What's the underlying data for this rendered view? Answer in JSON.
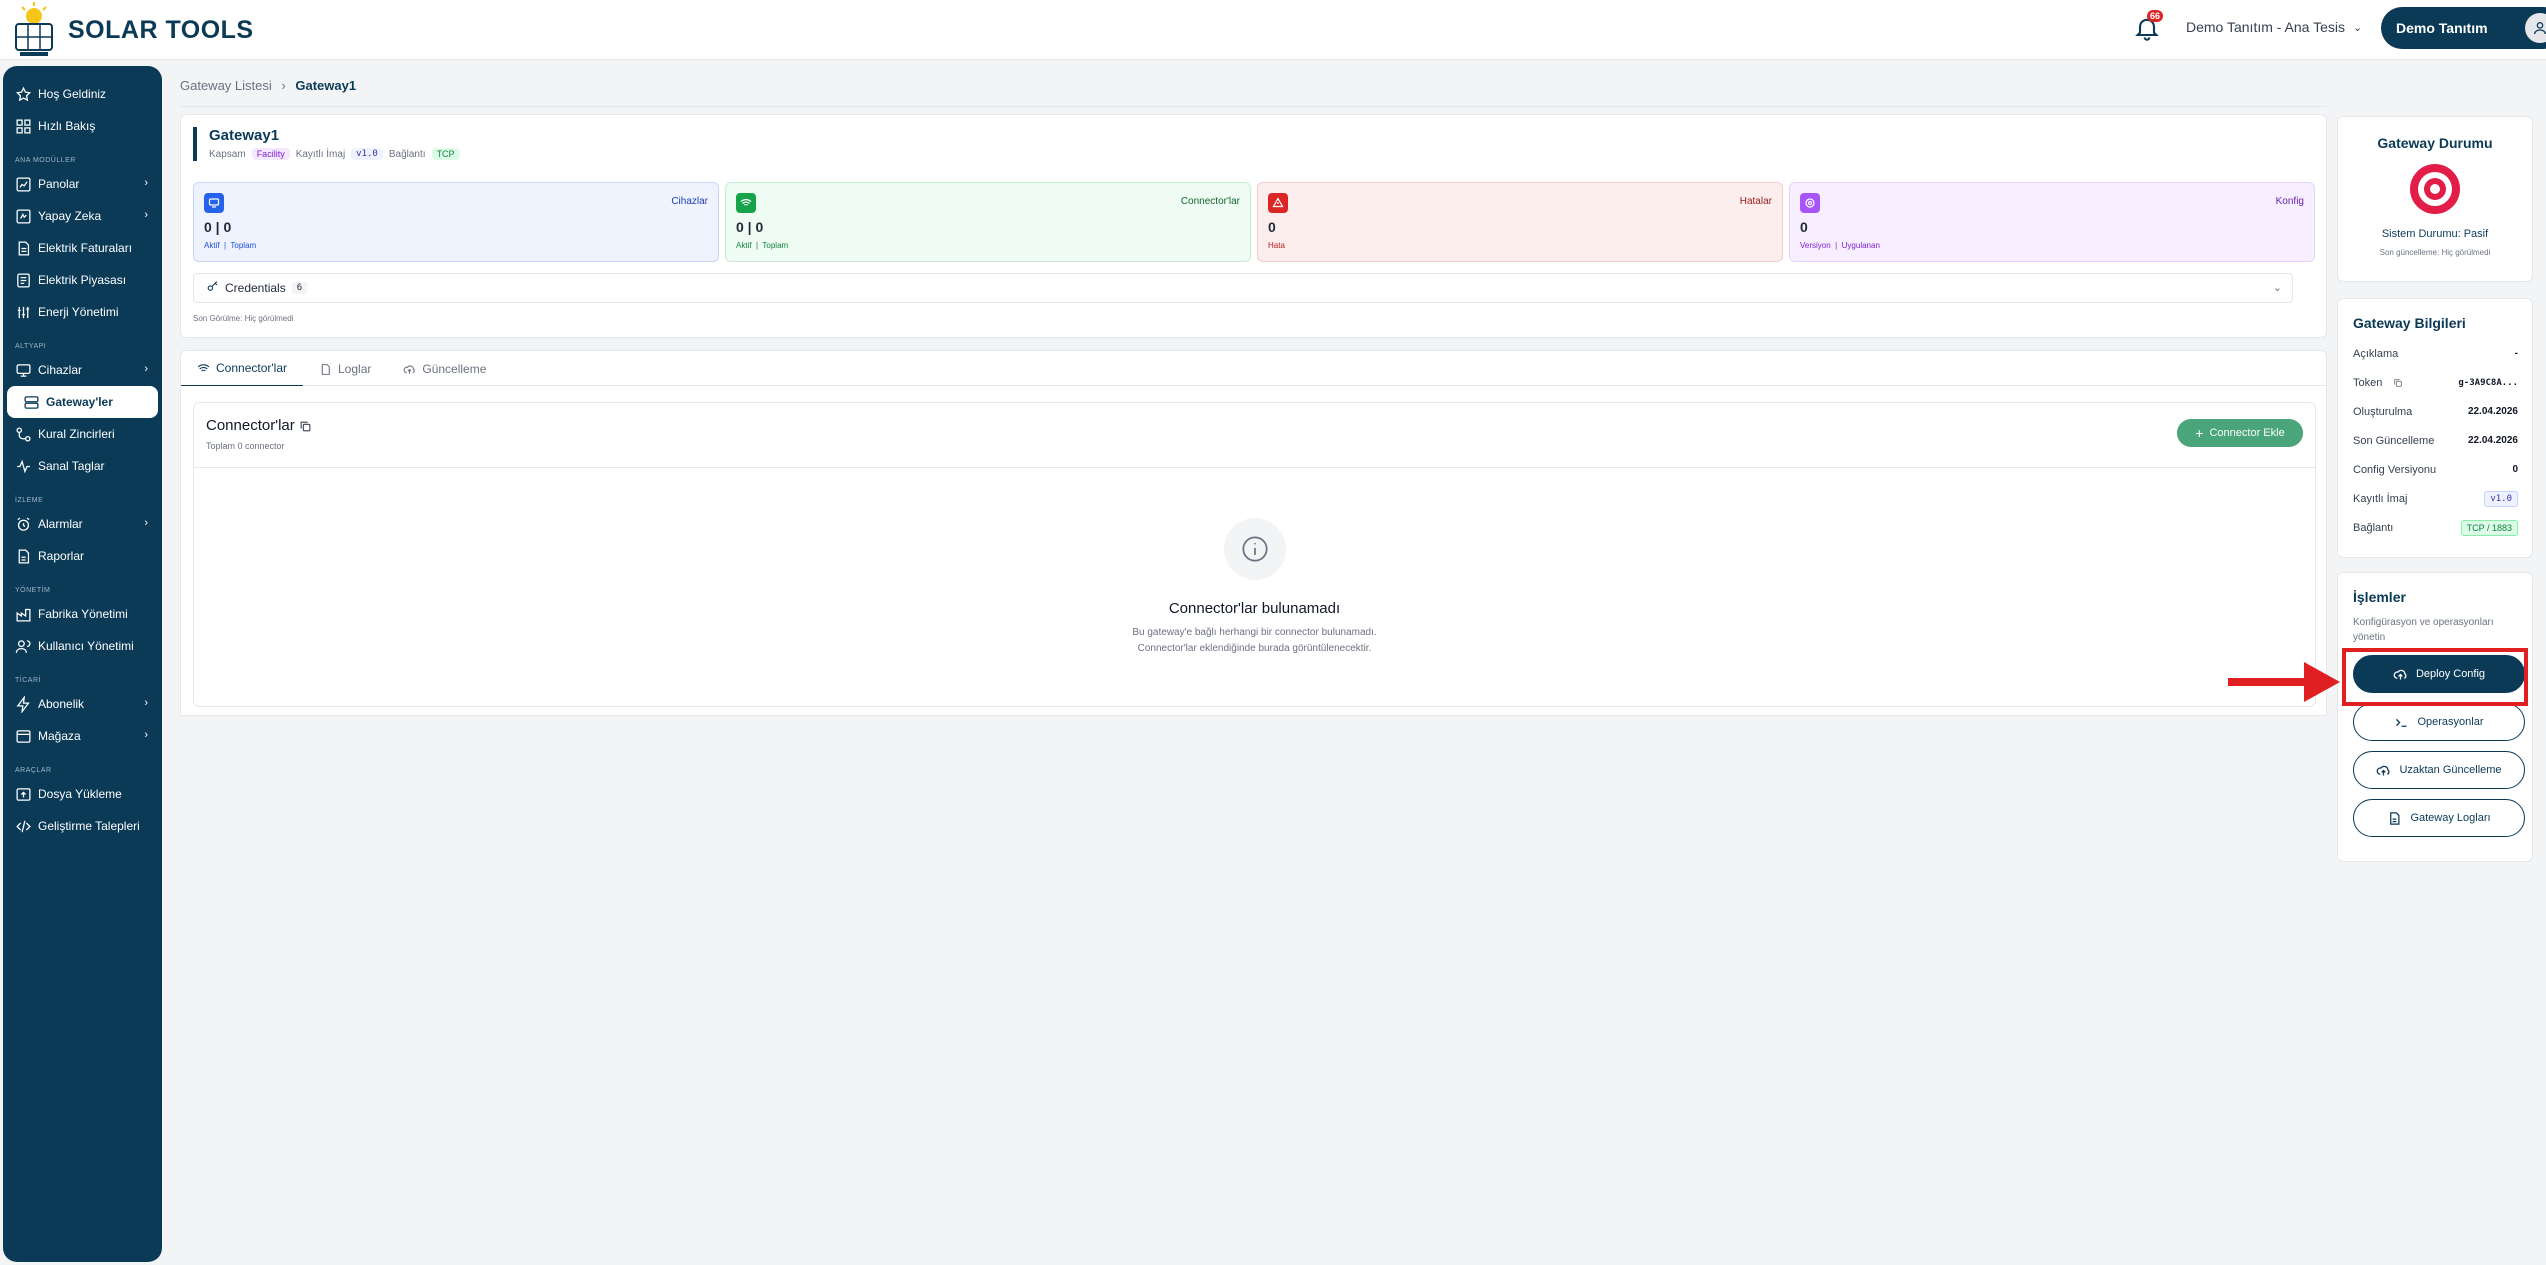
{
  "app": {
    "logo_text": "SOLAR TOOLS"
  },
  "header": {
    "notification_count": "66",
    "facility": "Demo Tanıtım - Ana Tesis",
    "user": "Demo Tanıtım"
  },
  "sidebar": {
    "items": [
      {
        "label": "Hoş Geldiniz",
        "icon": "star-icon"
      },
      {
        "label": "Hızlı Bakış",
        "icon": "grid-icon"
      }
    ],
    "sections": [
      {
        "title": "ANA MODÜLLER",
        "items": [
          {
            "label": "Panolar"
          },
          {
            "label": "Yapay Zeka"
          },
          {
            "label": "Elektrik Faturaları"
          },
          {
            "label": "Elektrik Piyasası"
          },
          {
            "label": "Enerji Yönetimi"
          }
        ]
      },
      {
        "title": "ALTYAPI",
        "items": [
          {
            "label": "Cihazlar"
          },
          {
            "label": "Gateway'ler"
          },
          {
            "label": "Kural Zincirleri"
          },
          {
            "label": "Sanal Taglar"
          }
        ]
      },
      {
        "title": "İZLEME",
        "items": [
          {
            "label": "Alarmlar"
          },
          {
            "label": "Raporlar"
          }
        ]
      },
      {
        "title": "YÖNETİM",
        "items": [
          {
            "label": "Fabrika Yönetimi"
          },
          {
            "label": "Kullanıcı Yönetimi"
          }
        ]
      },
      {
        "title": "TİCARİ",
        "items": [
          {
            "label": "Abonelik"
          },
          {
            "label": "Mağaza"
          }
        ]
      },
      {
        "title": "ARAÇLAR",
        "items": [
          {
            "label": "Dosya Yükleme"
          },
          {
            "label": "Geliştirme Talepleri"
          }
        ]
      }
    ]
  },
  "breadcrumb": {
    "parent": "Gateway Listesi",
    "current": "Gateway1"
  },
  "gateway": {
    "name": "Gateway1",
    "scope_label": "Kapsam",
    "scope": "Facility",
    "image_label": "Kayıtlı İmaj",
    "image": "v1.0",
    "conn_label": "Bağlantı",
    "conn": "TCP"
  },
  "stats": [
    {
      "label": "Cihazlar",
      "value": "0 | 0",
      "sub1": "Aktif",
      "sub2": "Toplam",
      "color": "#2563eb"
    },
    {
      "label": "Connector'lar",
      "value": "0 | 0",
      "sub1": "Aktif",
      "sub2": "Toplam",
      "color": "#16a34a"
    },
    {
      "label": "Hatalar",
      "value": "0",
      "sub1": "Hata",
      "sub2": "",
      "color": "#dc2626"
    },
    {
      "label": "Konfig",
      "value": "0",
      "sub1": "Versiyon",
      "sub2": "Uygulanan",
      "color": "#9333ea"
    }
  ],
  "credentials": {
    "label": "Credentials",
    "count": "6"
  },
  "last_seen": "Son Görülme: Hiç görülmedi",
  "tabs": [
    {
      "label": "Connector'lar"
    },
    {
      "label": "Loglar"
    },
    {
      "label": "Güncelleme"
    }
  ],
  "connectors": {
    "title": "Connector'lar",
    "subtitle": "Toplam 0 connector",
    "add": "Connector Ekle",
    "empty_title": "Connector'lar bulunamadı",
    "empty_l1": "Bu gateway'e bağlı herhangi bir connector bulunamadı.",
    "empty_l2": "Connector'lar eklendiğinde burada görüntülenecektir."
  },
  "status": {
    "title": "Gateway Durumu",
    "state": "Sistem Durumu: Pasif",
    "updated": "Son güncelleme: Hiç görülmedi"
  },
  "info": {
    "title": "Gateway Bilgileri",
    "rows": [
      {
        "k": "Açıklama",
        "v": "-"
      },
      {
        "k": "Token",
        "v": "g-3A9C8A..."
      },
      {
        "k": "Oluşturulma",
        "v": "22.04.2026"
      },
      {
        "k": "Son Güncelleme",
        "v": "22.04.2026"
      },
      {
        "k": "Config Versiyonu",
        "v": "0"
      },
      {
        "k": "Kayıtlı İmaj",
        "v": "v1.0"
      },
      {
        "k": "Bağlantı",
        "v": "TCP / 1883"
      }
    ]
  },
  "ops": {
    "title": "İşlemler",
    "desc": "Konfigürasyon ve operasyonları yönetin",
    "deploy": "Deploy Config",
    "operations": "Operasyonlar",
    "remote": "Uzaktan Güncelleme",
    "logs": "Gateway Logları"
  }
}
